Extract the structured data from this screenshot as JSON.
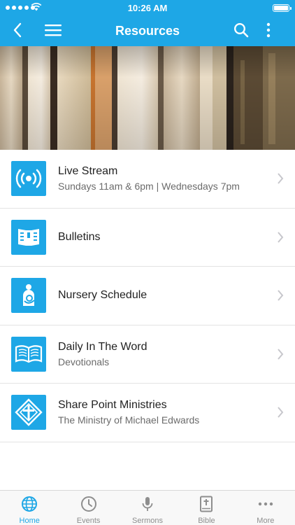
{
  "status_bar": {
    "time": "10:26 AM"
  },
  "nav": {
    "title": "Resources"
  },
  "list": [
    {
      "title": "Live Stream",
      "subtitle": "Sundays 11am & 6pm | Wednesdays 7pm",
      "icon": "broadcast-icon"
    },
    {
      "title": "Bulletins",
      "subtitle": "",
      "icon": "newspaper-icon"
    },
    {
      "title": "Nursery Schedule",
      "subtitle": "",
      "icon": "nursing-mother-icon"
    },
    {
      "title": "Daily In The Word",
      "subtitle": "Devotionals",
      "icon": "open-book-icon"
    },
    {
      "title": "Share Point Ministries",
      "subtitle": "The Ministry of Michael Edwards",
      "icon": "cross-diamond-icon"
    }
  ],
  "tabs": [
    {
      "label": "Home",
      "icon": "globe-icon",
      "active": true
    },
    {
      "label": "Events",
      "icon": "clock-icon",
      "active": false
    },
    {
      "label": "Sermons",
      "icon": "microphone-icon",
      "active": false
    },
    {
      "label": "Bible",
      "icon": "bible-icon",
      "active": false
    },
    {
      "label": "More",
      "icon": "ellipsis-icon",
      "active": false
    }
  ],
  "colors": {
    "accent": "#1ea7e6",
    "inactive_tab": "#8e8e8e",
    "chevron": "#c7c7cc"
  }
}
